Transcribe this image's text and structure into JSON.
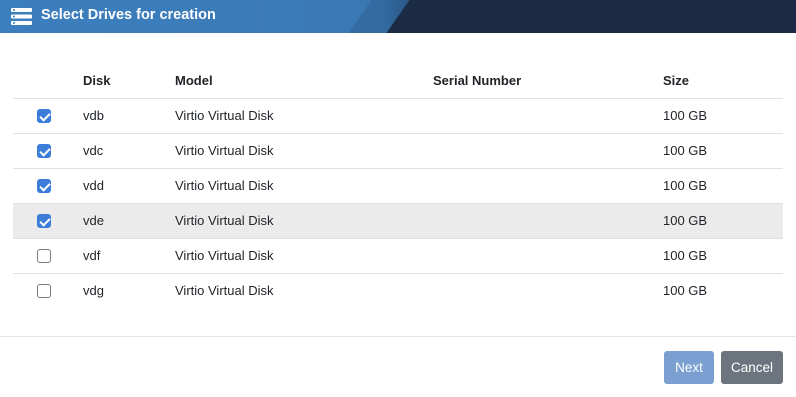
{
  "dialog": {
    "title": "Select Drives for creation",
    "header_icon": "server-list-icon"
  },
  "table": {
    "columns": [
      "",
      "Disk",
      "Model",
      "Serial Number",
      "Size"
    ],
    "rows": [
      {
        "checked": true,
        "disk": "vdb",
        "model": "Virtio Virtual Disk",
        "serial": "",
        "size": "100 GB"
      },
      {
        "checked": true,
        "disk": "vdc",
        "model": "Virtio Virtual Disk",
        "serial": "",
        "size": "100 GB"
      },
      {
        "checked": true,
        "disk": "vdd",
        "model": "Virtio Virtual Disk",
        "serial": "",
        "size": "100 GB"
      },
      {
        "checked": true,
        "disk": "vde",
        "model": "Virtio Virtual Disk",
        "serial": "",
        "size": "100 GB",
        "highlighted": true
      },
      {
        "checked": false,
        "disk": "vdf",
        "model": "Virtio Virtual Disk",
        "serial": "",
        "size": "100 GB"
      },
      {
        "checked": false,
        "disk": "vdg",
        "model": "Virtio Virtual Disk",
        "serial": "",
        "size": "100 GB"
      }
    ]
  },
  "buttons": {
    "next_label": "Next",
    "cancel_label": "Cancel"
  },
  "colors": {
    "checkbox_checked": "#3b7dd8",
    "next_button": "#7a9fd0",
    "cancel_button": "#6c757d",
    "row_highlight": "#ebebeb"
  }
}
